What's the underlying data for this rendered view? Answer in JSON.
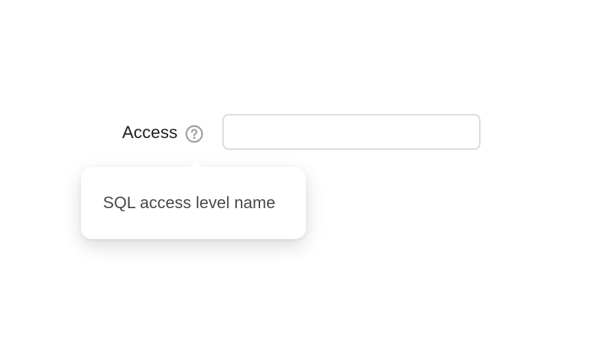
{
  "form": {
    "access_label": "Access",
    "access_value": "",
    "access_placeholder": ""
  },
  "tooltip": {
    "text": "SQL access level name"
  },
  "icons": {
    "help": "question-circle-icon"
  },
  "colors": {
    "label": "#222222",
    "icon": "#a0a0a0",
    "input_border": "#d9d9d9",
    "tooltip_text": "#4a4a4a",
    "background": "#ffffff"
  }
}
